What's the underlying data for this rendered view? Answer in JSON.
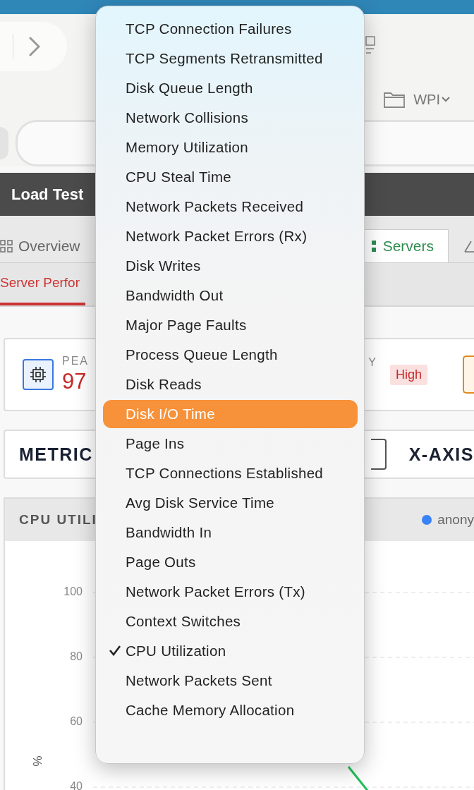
{
  "browser": {
    "folder": "WPI"
  },
  "header": {
    "title": "Load Test"
  },
  "tabs": [
    {
      "label": "Overview",
      "selected": false
    },
    {
      "label": "Servers",
      "selected": true
    }
  ],
  "subtabs": [
    {
      "label": "Server Perfor",
      "selected": true
    }
  ],
  "summary": {
    "label": "PEA",
    "value": "97",
    "label_2": "Y",
    "badge": "High"
  },
  "controls": {
    "metric_label": "METRIC",
    "xaxis_label": "X-AXIS"
  },
  "chart": {
    "title": "CPU UTILI",
    "legend": [
      {
        "name": "anony",
        "color": "#3b82f6"
      }
    ],
    "y_axis": {
      "label": "%",
      "ticks": [
        "100",
        "80",
        "60",
        "40"
      ]
    }
  },
  "menu": {
    "items": [
      {
        "label": "TCP Connection Failures",
        "checked": false,
        "highlighted": false
      },
      {
        "label": "TCP Segments Retransmitted",
        "checked": false,
        "highlighted": false
      },
      {
        "label": "Disk Queue Length",
        "checked": false,
        "highlighted": false
      },
      {
        "label": "Network Collisions",
        "checked": false,
        "highlighted": false
      },
      {
        "label": "Memory Utilization",
        "checked": false,
        "highlighted": false
      },
      {
        "label": "CPU Steal Time",
        "checked": false,
        "highlighted": false
      },
      {
        "label": "Network Packets Received",
        "checked": false,
        "highlighted": false
      },
      {
        "label": "Network Packet Errors (Rx)",
        "checked": false,
        "highlighted": false
      },
      {
        "label": "Disk Writes",
        "checked": false,
        "highlighted": false
      },
      {
        "label": "Bandwidth Out",
        "checked": false,
        "highlighted": false
      },
      {
        "label": "Major Page Faults",
        "checked": false,
        "highlighted": false
      },
      {
        "label": "Process Queue Length",
        "checked": false,
        "highlighted": false
      },
      {
        "label": "Disk Reads",
        "checked": false,
        "highlighted": false
      },
      {
        "label": "Disk I/O Time",
        "checked": false,
        "highlighted": true
      },
      {
        "label": "Page Ins",
        "checked": false,
        "highlighted": false
      },
      {
        "label": "TCP Connections Established",
        "checked": false,
        "highlighted": false
      },
      {
        "label": "Avg Disk Service Time",
        "checked": false,
        "highlighted": false
      },
      {
        "label": "Bandwidth In",
        "checked": false,
        "highlighted": false
      },
      {
        "label": "Page Outs",
        "checked": false,
        "highlighted": false
      },
      {
        "label": "Network Packet Errors (Tx)",
        "checked": false,
        "highlighted": false
      },
      {
        "label": "Context Switches",
        "checked": false,
        "highlighted": false
      },
      {
        "label": "CPU Utilization",
        "checked": true,
        "highlighted": false
      },
      {
        "label": "Network Packets Sent",
        "checked": false,
        "highlighted": false
      },
      {
        "label": "Cache Memory Allocation",
        "checked": false,
        "highlighted": false
      }
    ]
  }
}
